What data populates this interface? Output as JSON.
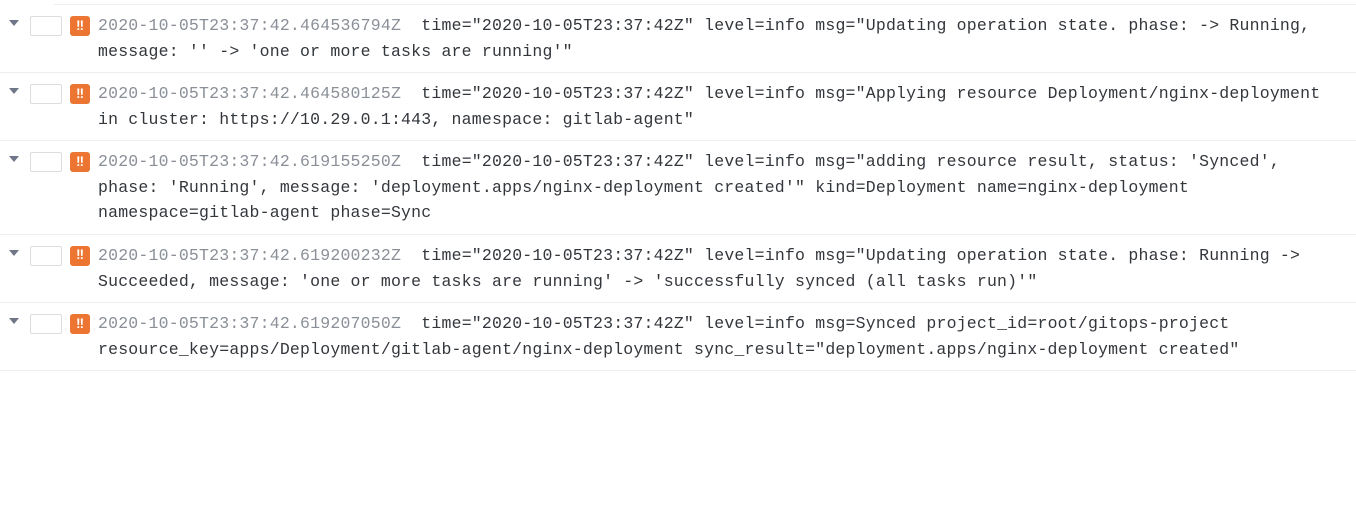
{
  "badge_glyph": "!!",
  "logs": [
    {
      "timestamp": "2020-10-05T23:37:42.464536794Z",
      "message": "time=\"2020-10-05T23:37:42Z\" level=info msg=\"Updating operation state. phase: -> Running, message: '' -> 'one or more tasks are running'\""
    },
    {
      "timestamp": "2020-10-05T23:37:42.464580125Z",
      "message": "time=\"2020-10-05T23:37:42Z\" level=info msg=\"Applying resource Deployment/nginx-deployment in cluster: https://10.29.0.1:443, namespace: gitlab-agent\""
    },
    {
      "timestamp": "2020-10-05T23:37:42.619155250Z",
      "message": "time=\"2020-10-05T23:37:42Z\" level=info msg=\"adding resource result, status: 'Synced', phase: 'Running', message: 'deployment.apps/nginx-deployment created'\" kind=Deployment name=nginx-deployment namespace=gitlab-agent phase=Sync"
    },
    {
      "timestamp": "2020-10-05T23:37:42.619200232Z",
      "message": "time=\"2020-10-05T23:37:42Z\" level=info msg=\"Updating operation state. phase: Running -> Succeeded, message: 'one or more tasks are running' -> 'successfully synced (all tasks run)'\""
    },
    {
      "timestamp": "2020-10-05T23:37:42.619207050Z",
      "message": "time=\"2020-10-05T23:37:42Z\" level=info msg=Synced project_id=root/gitops-project resource_key=apps/Deployment/gitlab-agent/nginx-deployment sync_result=\"deployment.apps/nginx-deployment created\""
    }
  ]
}
